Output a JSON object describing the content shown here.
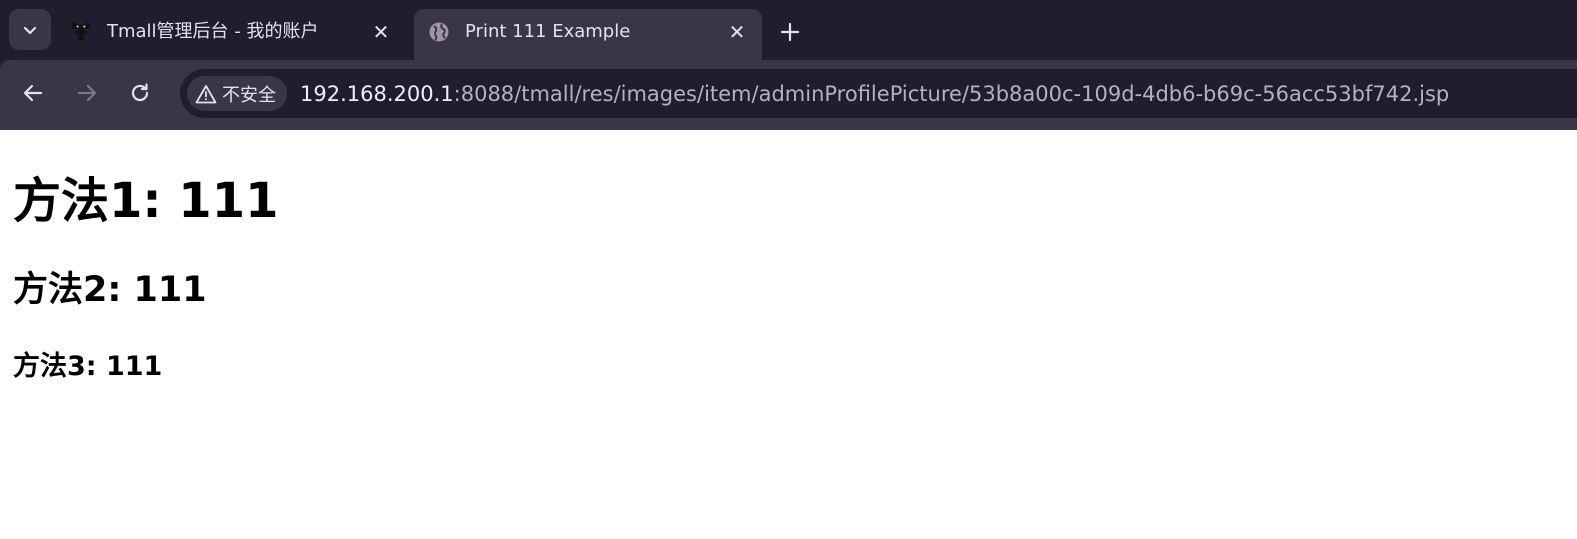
{
  "tabs": [
    {
      "title": "Tmall管理后台 - 我的账户",
      "favicon": "tmall-logo-icon",
      "active": false
    },
    {
      "title": "Print 111 Example",
      "favicon": "globe-icon",
      "active": true
    }
  ],
  "toolbar": {
    "security_label": "不安全",
    "url_host": "192.168.200.1",
    "url_rest": ":8088/tmall/res/images/item/adminProfilePicture/53b8a00c-109d-4db6-b69c-56acc53bf742.jsp"
  },
  "page": {
    "heading1": "方法1: 111",
    "heading2": "方法2: 111",
    "heading3": "方法3: 111"
  },
  "colors": {
    "chrome_bg": "#211d2e",
    "toolbar_bg": "#3b3548",
    "chrome_text": "#e6e1ee"
  }
}
